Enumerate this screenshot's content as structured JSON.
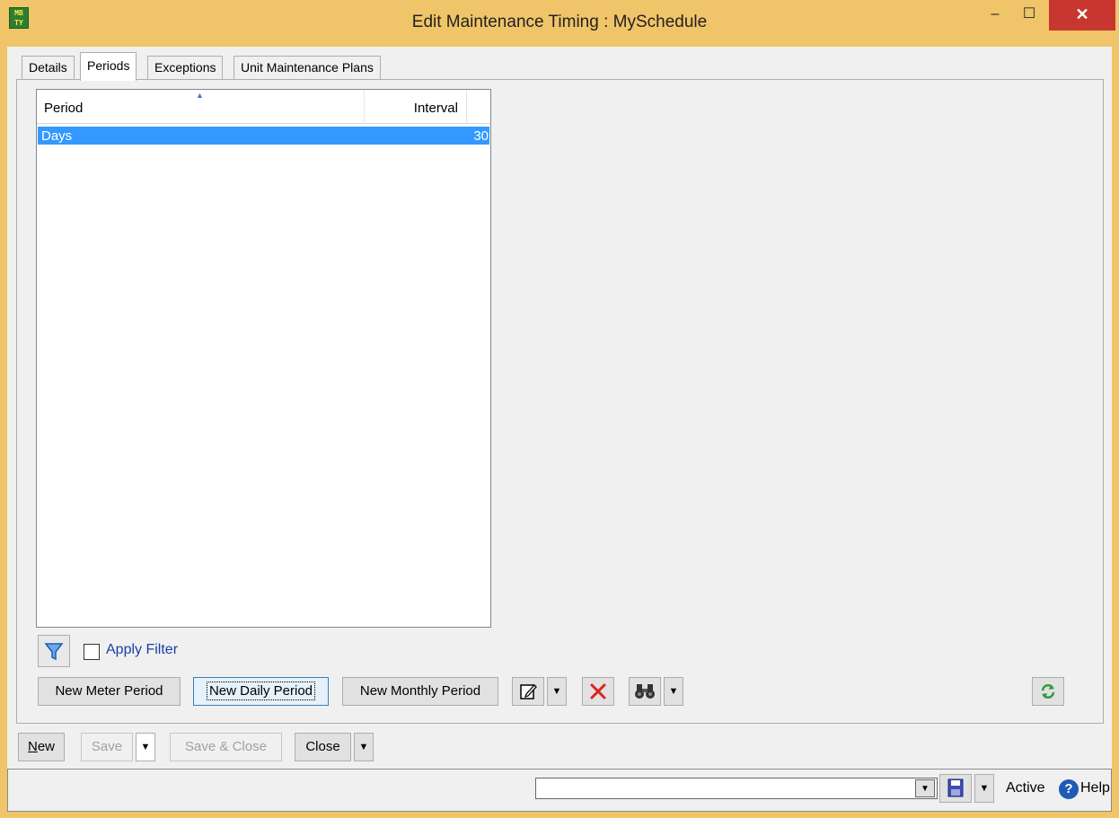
{
  "window": {
    "title": "Edit Maintenance Timing : MySchedule",
    "app_icon_text": "MB\nTY",
    "minimize_glyph": "–",
    "maximize_glyph": "☐",
    "close_glyph": "✕"
  },
  "tabs": [
    {
      "label": "Details",
      "active": false
    },
    {
      "label": "Periods",
      "active": true
    },
    {
      "label": "Exceptions",
      "active": false
    },
    {
      "label": "Unit Maintenance Plans",
      "active": false
    }
  ],
  "list": {
    "columns": [
      "Period",
      "Interval"
    ],
    "sort_indicator": "▲",
    "rows": [
      {
        "period": "Days",
        "interval": "30",
        "selected": true
      }
    ]
  },
  "filter": {
    "label": "Apply Filter",
    "checked": false
  },
  "period_buttons": {
    "new_meter": "New Meter Period",
    "new_daily": "New Daily Period",
    "new_monthly": "New Monthly Period",
    "dropdown_glyph": "▼"
  },
  "footer": {
    "new_prefix": "N",
    "new_rest": "ew",
    "save": "Save",
    "save_close": "Save & Close",
    "close": "Close"
  },
  "status": {
    "combo_value": "",
    "state": "Active",
    "help_glyph": "?",
    "help_label": "Help"
  },
  "colors": {
    "titlebar": "#f0c468",
    "selection": "#3399ff",
    "close_button": "#c7372f"
  },
  "icons": [
    "app-logo-icon",
    "filter-icon",
    "edit-icon",
    "delete-icon",
    "binoculars-icon",
    "refresh-icon",
    "save-layout-icon",
    "help-icon"
  ]
}
